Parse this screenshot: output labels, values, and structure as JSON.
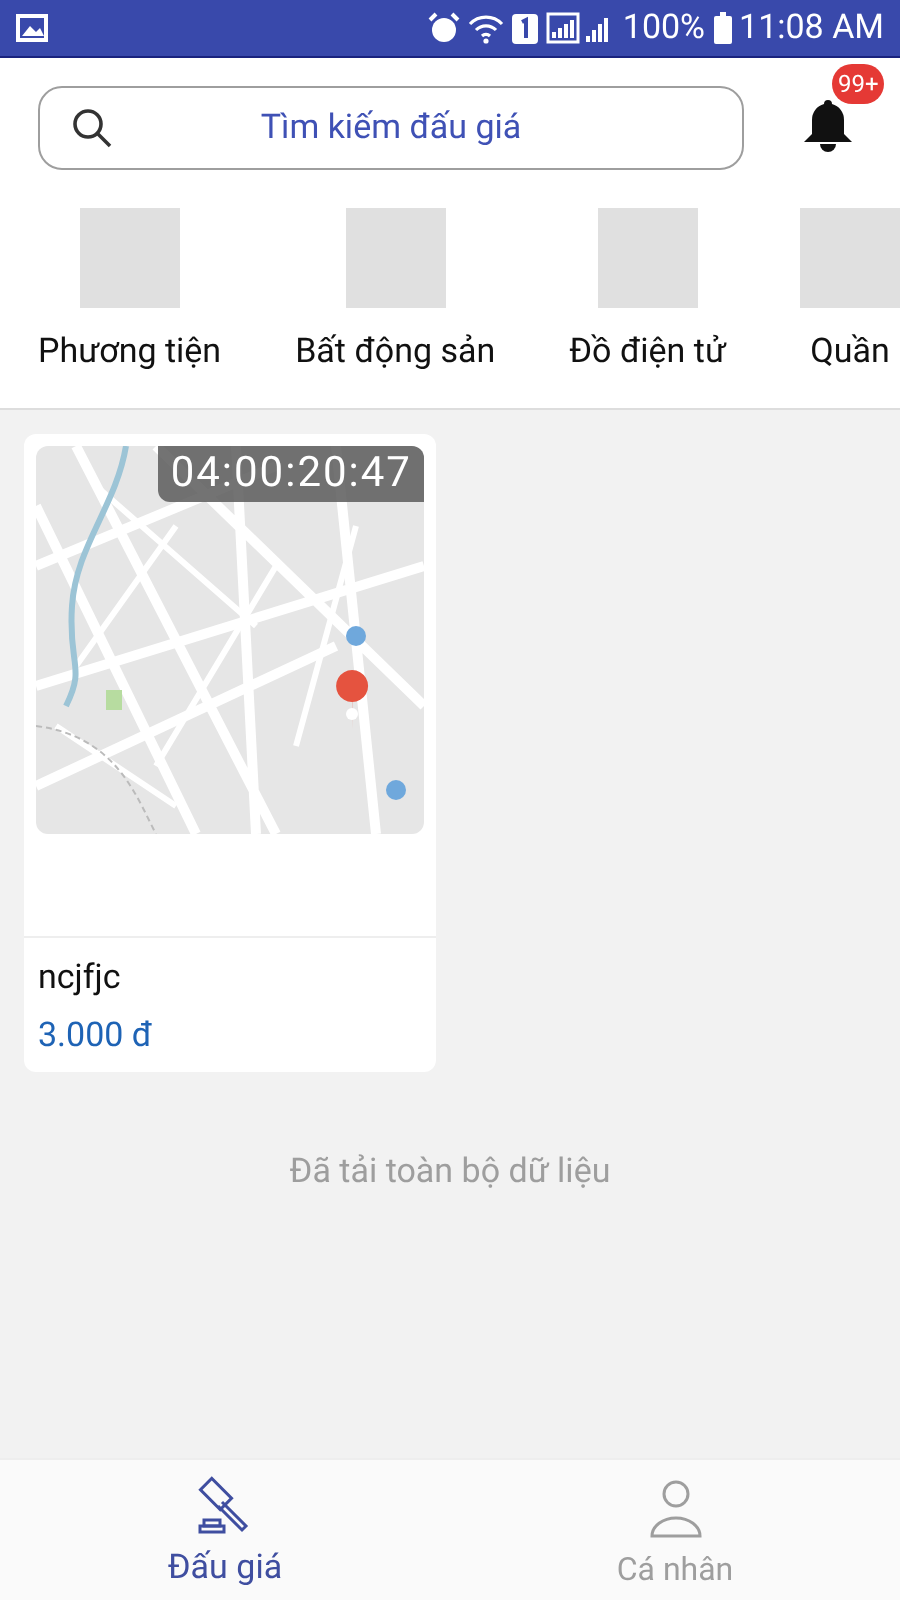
{
  "status_bar": {
    "battery": "100%",
    "time": "11:08 AM"
  },
  "search": {
    "placeholder": "Tìm kiếm đấu giá"
  },
  "notifications": {
    "badge": "99+"
  },
  "categories": [
    {
      "label": "Phương tiện"
    },
    {
      "label": "Bất động sản"
    },
    {
      "label": "Đồ điện tử"
    },
    {
      "label": "Quần"
    }
  ],
  "auctions": [
    {
      "kind": "picture",
      "countdown": "04:00:20:47",
      "title": "ncjfjc",
      "price": "3.000 đ"
    }
  ],
  "footer_note": "Đã tải toàn bộ dữ liệu",
  "nav": [
    {
      "label": "Đấu giá",
      "selected": true
    },
    {
      "label": "Cá nhân",
      "selected": false
    }
  ]
}
